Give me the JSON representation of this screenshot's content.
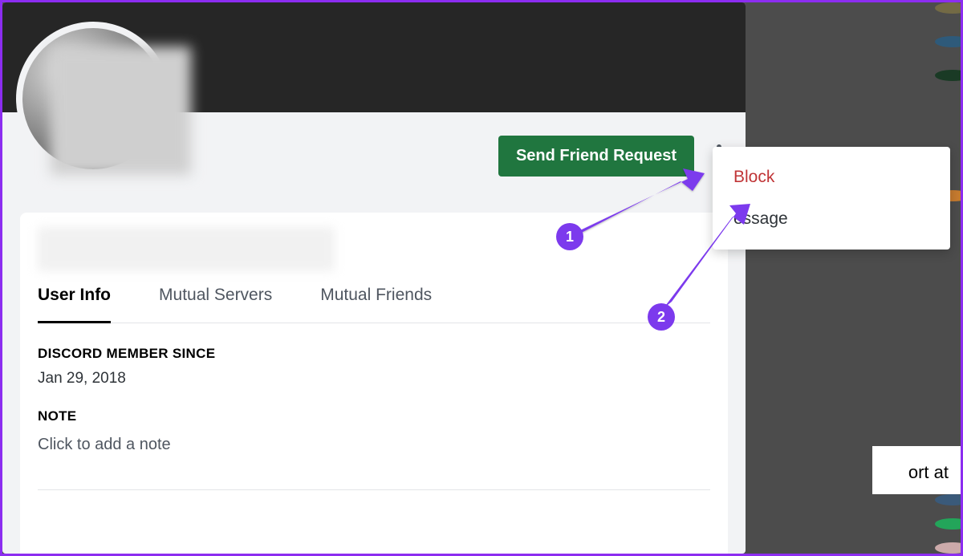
{
  "profile": {
    "friend_button_label": "Send Friend Request",
    "tabs": {
      "user_info": "User Info",
      "mutual_servers": "Mutual Servers",
      "mutual_friends": "Mutual Friends"
    },
    "member_since_label": "DISCORD MEMBER SINCE",
    "member_since_value": "Jan 29, 2018",
    "note_label": "NOTE",
    "note_placeholder": "Click to add a note"
  },
  "context_menu": {
    "block": "Block",
    "message_partial": "essage"
  },
  "annotations": {
    "step1": "1",
    "step2": "2"
  },
  "background": {
    "partial_text": "ort at"
  }
}
